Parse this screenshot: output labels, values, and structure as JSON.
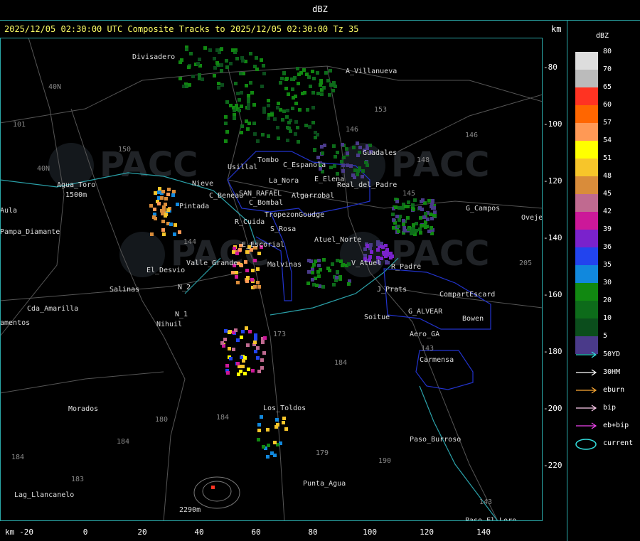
{
  "window": {
    "title": "dBZ"
  },
  "header": {
    "text": "2025/12/05 02:30:00 UTC Composite Tracks to 2025/12/05 02:30:00 Tz 35",
    "units": "km"
  },
  "axes": {
    "x_unit": "km",
    "x_ticks": [
      "-20",
      "0",
      "20",
      "40",
      "60",
      "80",
      "100",
      "120",
      "140"
    ],
    "y_ticks": [
      "-80",
      "-100",
      "-120",
      "-140",
      "-160",
      "-180",
      "-200",
      "-220"
    ]
  },
  "legend": {
    "title": "dBZ",
    "scale": [
      {
        "label": "80",
        "color": "#dddddd"
      },
      {
        "label": "70",
        "color": "#bbbbbb"
      },
      {
        "label": "65",
        "color": "#ff3322"
      },
      {
        "label": "60",
        "color": "#ff6600"
      },
      {
        "label": "57",
        "color": "#ff9955"
      },
      {
        "label": "54",
        "color": "#ffff00"
      },
      {
        "label": "51",
        "color": "#f7c52a"
      },
      {
        "label": "48",
        "color": "#d98c3a"
      },
      {
        "label": "45",
        "color": "#c06a90"
      },
      {
        "label": "42",
        "color": "#cc1899"
      },
      {
        "label": "39",
        "color": "#7a22cc"
      },
      {
        "label": "36",
        "color": "#2244ee"
      },
      {
        "label": "35",
        "color": "#1188dd"
      },
      {
        "label": "30",
        "color": "#118811"
      },
      {
        "label": "20",
        "color": "#0d6b1a"
      },
      {
        "label": "10",
        "color": "#0b4d1c"
      },
      {
        "label": "5",
        "color": "#4a3a8a"
      }
    ],
    "tracks": [
      {
        "label": "50YD",
        "color": "#33dddd"
      },
      {
        "label": "30HM",
        "color": "#ffffff"
      },
      {
        "label": "eburn",
        "color": "#ffaa33"
      },
      {
        "label": "bip",
        "color": "#ffccee"
      },
      {
        "label": "eb+bip",
        "color": "#ee44ee"
      },
      {
        "label": "current",
        "color": "#33dddd"
      }
    ]
  },
  "map": {
    "places": [
      {
        "t": "Divisadero"
      },
      {
        "t": "A_Villanueva"
      },
      {
        "t": "Guadales"
      },
      {
        "t": "Usillal"
      },
      {
        "t": "Tombo"
      },
      {
        "t": "C_Espanola"
      },
      {
        "t": "La_Nora"
      },
      {
        "t": "E_Elena"
      },
      {
        "t": "Real_del_Padre"
      },
      {
        "t": "C_Beneau"
      },
      {
        "t": "SAN_RAFAEL"
      },
      {
        "t": "Algarrobal"
      },
      {
        "t": "C_Bombal"
      },
      {
        "t": "Tropezon"
      },
      {
        "t": "Goudge"
      },
      {
        "t": "R_Cuida"
      },
      {
        "t": "S_Rosa"
      },
      {
        "t": "Atuel_Norte"
      },
      {
        "t": "V_Atuel"
      },
      {
        "t": "R_Padre"
      },
      {
        "t": "E_Escorial"
      },
      {
        "t": "Valle_Grande"
      },
      {
        "t": "Malvinas"
      },
      {
        "t": "El_Desvio"
      },
      {
        "t": "Salinas"
      },
      {
        "t": "N_2"
      },
      {
        "t": "N_1"
      },
      {
        "t": "Nihuil"
      },
      {
        "t": "J_Prats"
      },
      {
        "t": "CompartEscard"
      },
      {
        "t": "G_ALVEAR"
      },
      {
        "t": "Bowen"
      },
      {
        "t": "Soitue"
      },
      {
        "t": "Aero_GA"
      },
      {
        "t": "Carmensa"
      },
      {
        "t": "Los_Toldos"
      },
      {
        "t": "Paso_Burroso"
      },
      {
        "t": "Punta_Agua"
      },
      {
        "t": "Paso_El_Loro"
      },
      {
        "t": "G_Campos"
      },
      {
        "t": "Ovejer"
      },
      {
        "t": "Agua_Toro"
      },
      {
        "t": "Pampa_Diamante"
      },
      {
        "t": "Aula"
      },
      {
        "t": "Cda_Amarilla"
      },
      {
        "t": "amentos"
      },
      {
        "t": "Morados"
      },
      {
        "t": "Lag_Llancanelo"
      },
      {
        "t": "Pintada"
      },
      {
        "t": "Nieve"
      },
      {
        "t": "2290m"
      },
      {
        "t": "1500m"
      }
    ],
    "routes": [
      "40N",
      "40N",
      "101",
      "150",
      "153",
      "146",
      "148",
      "145",
      "144",
      "205",
      "180",
      "184",
      "173",
      "184",
      "179",
      "190",
      "143",
      "143",
      "184",
      "183",
      "184",
      "146"
    ],
    "watermark": "PACC"
  }
}
